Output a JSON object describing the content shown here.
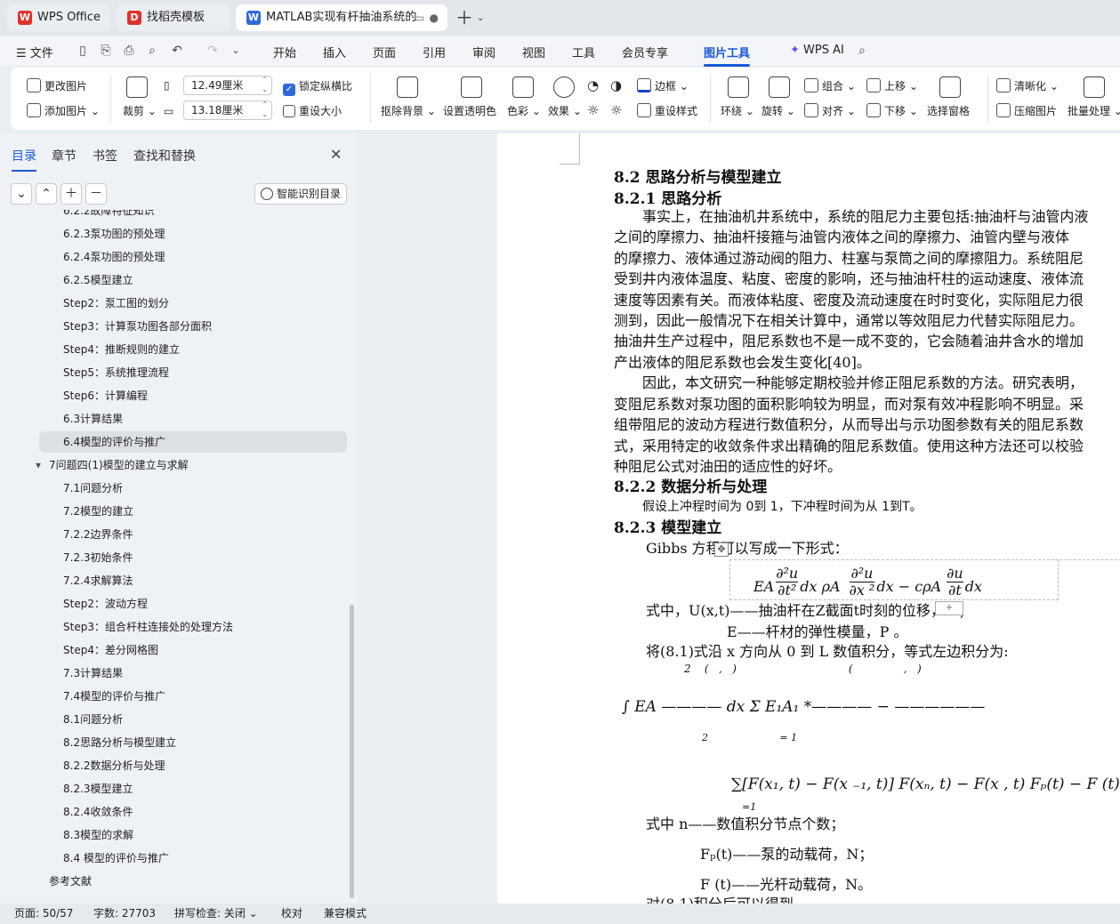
{
  "tabs": [
    {
      "label": "WPS Office",
      "icon": "wps-logo-icon",
      "color": "#e0322b"
    },
    {
      "label": "找稻壳模板",
      "icon": "docer-icon",
      "color": "#e0322b"
    },
    {
      "label": "MATLAB实现有杆抽油系统的",
      "icon": "wps-writer-icon",
      "color": "#2f6bd8"
    }
  ],
  "menu": {
    "file": "文件",
    "items": [
      "开始",
      "插入",
      "页面",
      "引用",
      "审阅",
      "视图",
      "工具",
      "会员专享",
      "图片工具"
    ],
    "active": "图片工具",
    "ai": "WPS AI"
  },
  "ribbon": {
    "change_image": "更改图片",
    "add_image": "添加图片",
    "crop": "裁剪",
    "width_value": "12.49厘米",
    "height_value": "13.18厘米",
    "lock_ratio": "锁定纵横比",
    "reset_size": "重设大小",
    "remove_bg": "抠除背景",
    "set_transparent": "设置透明色",
    "color": "色彩",
    "effect": "效果",
    "border": "边框",
    "reset_style": "重设样式",
    "wrap": "环绕",
    "rotate": "旋转",
    "group": "组合",
    "align": "对齐",
    "move_up": "上移",
    "move_down": "下移",
    "selection_pane": "选择窗格",
    "sharpen": "清晰化",
    "compress": "压缩图片",
    "batch": "批量处理"
  },
  "sidebar": {
    "tabs": [
      "目录",
      "章节",
      "书签",
      "查找和替换"
    ],
    "smart_button": "智能识别目录",
    "toc": [
      {
        "label": "6.2.2故障特征知识",
        "level": 2
      },
      {
        "label": "6.2.3泵功图的预处理",
        "level": 2
      },
      {
        "label": "6.2.4泵功图的预处理",
        "level": 2
      },
      {
        "label": "6.2.5模型建立",
        "level": 2
      },
      {
        "label": "Step2：泵工图的划分",
        "level": 2
      },
      {
        "label": "Step3：计算泵功图各部分面积",
        "level": 2
      },
      {
        "label": "Step4：推断规则的建立",
        "level": 2
      },
      {
        "label": "Step5：系统推理流程",
        "level": 2
      },
      {
        "label": "Step6：计算编程",
        "level": 2
      },
      {
        "label": "6.3计算结果",
        "level": 2
      },
      {
        "label": "6.4模型的评价与推广",
        "level": 2,
        "selected": true
      },
      {
        "label": "7问题四(1)模型的建立与求解",
        "level": 1,
        "expanded": true
      },
      {
        "label": "7.1问题分析",
        "level": 2
      },
      {
        "label": "7.2模型的建立",
        "level": 2
      },
      {
        "label": "7.2.2边界条件",
        "level": 2
      },
      {
        "label": "7.2.3初始条件",
        "level": 2
      },
      {
        "label": "7.2.4求解算法",
        "level": 2
      },
      {
        "label": "Step2：波动方程",
        "level": 2
      },
      {
        "label": "Step3：组合杆柱连接处的处理方法",
        "level": 2
      },
      {
        "label": "Step4：差分网格图",
        "level": 2
      },
      {
        "label": "7.3计算结果",
        "level": 2
      },
      {
        "label": "7.4模型的评价与推广",
        "level": 2
      },
      {
        "label": "8.1问题分析",
        "level": 2
      },
      {
        "label": "8.2思路分析与模型建立",
        "level": 2
      },
      {
        "label": "8.2.2数据分析与处理",
        "level": 2
      },
      {
        "label": "8.2.3模型建立",
        "level": 2
      },
      {
        "label": "8.2.4收敛条件",
        "level": 2
      },
      {
        "label": "8.3模型的求解",
        "level": 2
      },
      {
        "label": "8.4 模型的评价与推广",
        "level": 2
      },
      {
        "label": "参考文献",
        "level": 1
      }
    ]
  },
  "document": {
    "h_82": "8.2 思路分析与模型建立",
    "h_821": "8.2.1  思路分析",
    "p1": [
      "　　事实上，在抽油机井系统中，系统的阻尼力主要包括:抽油杆与油管内液",
      "之间的摩擦力、抽油杆接箍与油管内液体之间的摩擦力、油管内壁与液体",
      "的摩擦力、液体通过游动阀的阻力、柱塞与泵筒之间的摩擦阻力。系统阻尼",
      "受到井内液体温度、粘度、密度的影响，还与抽油杆柱的运动速度、液体流",
      "速度等因素有关。而液体粘度、密度及流动速度在时时变化，实际阻尼力很",
      "测到，因此一般情况下在相关计算中，通常以等效阻尼力代替实际阻尼力。",
      "抽油井生产过程中，阻尼系数也不是一成不变的，它会随着油井含水的增加",
      "产出液体的阻尼系数也会发生变化[40]。"
    ],
    "p2": [
      "　　因此，本文研究一种能够定期校验并修正阻尼系数的方法。研究表明，",
      "变阻尼系数对泵功图的面积影响较为明显，而对泵有效冲程影响不明显。采",
      "组带阻尼的波动方程进行数值积分，从而导出与示功图参数有关的阻尼系数",
      "式，采用特定的收敛条件求出精确的阻尼系数值。使用这种方法还可以校验",
      "种阻尼公式对油田的适应性的好坏。"
    ],
    "h_822": "8.2.2  数据分析与处理",
    "p3": "假设上冲程时间为 0到  1，下冲程时间为从  1到T。",
    "h_823": "8.2.3  模型建立",
    "p4": "Gibbs 方程可以写成一下形式：",
    "eq1": "EA ∂²u/∂t² dx ρA ∂²u/∂x² dx − cρA ∂u/∂t dx",
    "p5": "式中，U(x,t)——抽油杆在Z截面t时刻的位移，m；",
    "p6": "E——杆材的弹性模量，P 。",
    "p7": "将(8.1)式沿 x 方向从 0 到 L 数值积分，等式左边积分为:",
    "eq2": "∫ EA ———— dx   Σ E₁A₁ *———— − ——————",
    "eq3": "∑[F(x₁, t) − F(x ₋₁, t)] F(xₙ, t) − F(x , t)  Fₚ(t) − F (t)",
    "p8": "式中    n——数值积分节点个数；",
    "p9": "Fₚ(t)——泵的动载荷，N；",
    "p10": "F (t)——光杆动载荷，N。",
    "p11": "对(8.1)积分后可以得到"
  },
  "status": {
    "page": "页面: 50/57",
    "words": "字数: 27703",
    "spell": "拼写检查: 关闭",
    "proof": "校对",
    "compat": "兼容模式"
  }
}
